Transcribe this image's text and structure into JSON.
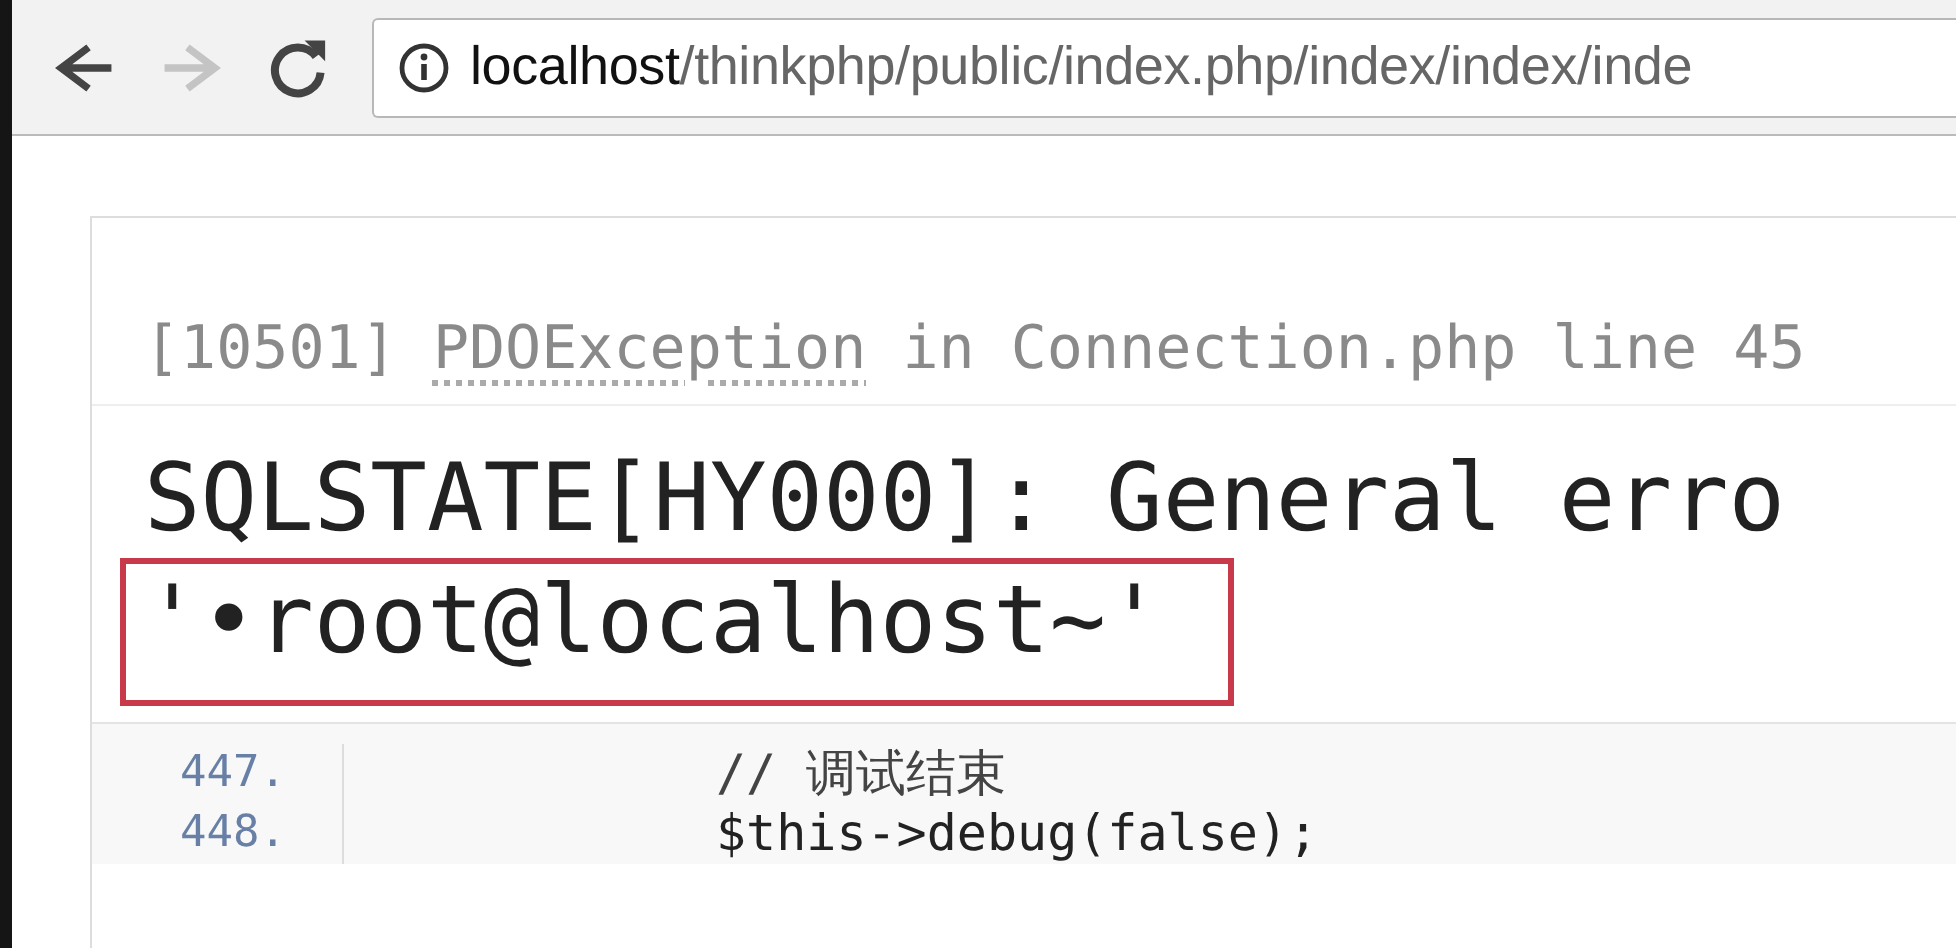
{
  "toolbar": {
    "buttons": [
      {
        "kind": "back",
        "disabled": false
      },
      {
        "kind": "forward",
        "disabled": true
      },
      {
        "kind": "reload",
        "disabled": false
      }
    ],
    "address": {
      "host": "localhost",
      "path": "/thinkphp/public/index.php/index/index/inde"
    }
  },
  "error": {
    "code": "[10501]",
    "exception": "PDOException",
    "location": "in Connection.php line 45",
    "message": "SQLSTATE[HY000]: General erro",
    "highlighted": "'•root@localhost~'"
  },
  "source": {
    "lines": [
      {
        "number": "447.",
        "code": "// 调试结束",
        "kind": "comment"
      },
      {
        "number": "448.",
        "code": "$this->debug(false);",
        "kind": "code"
      }
    ]
  }
}
